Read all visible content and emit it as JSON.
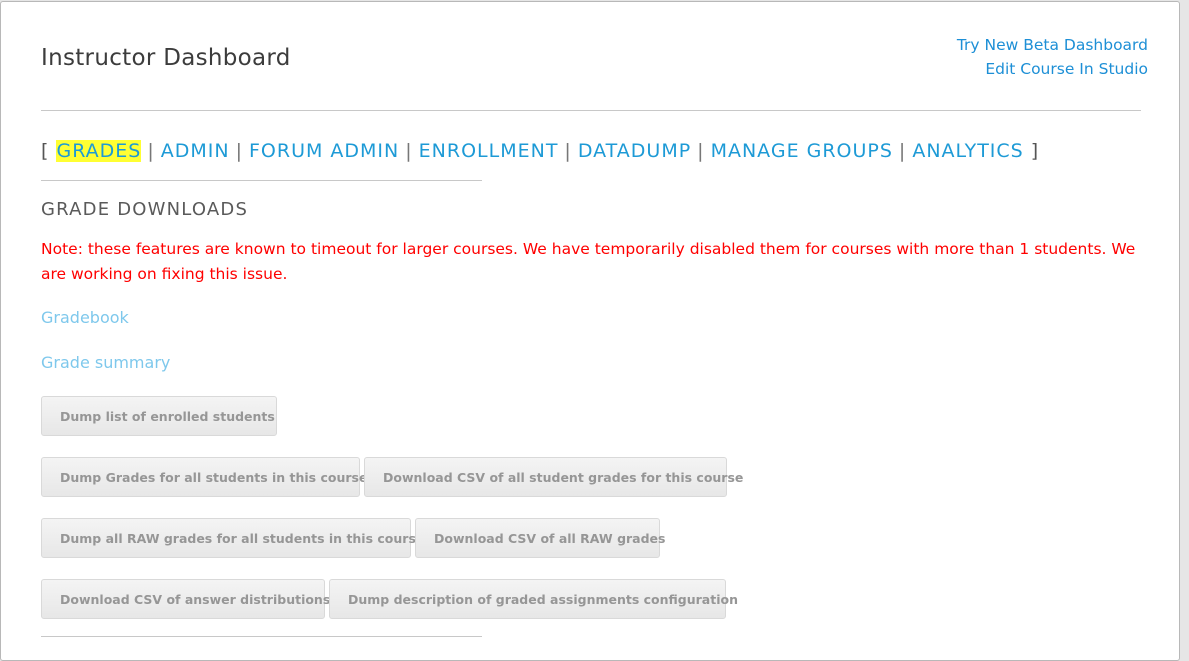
{
  "header": {
    "title": "Instructor Dashboard",
    "links": [
      {
        "label": "Try New Beta Dashboard"
      },
      {
        "label": "Edit Course In Studio"
      }
    ]
  },
  "tabs": {
    "open_bracket": "[",
    "close_bracket": "]",
    "separator": "|",
    "items": [
      {
        "label": "GRADES",
        "active": true
      },
      {
        "label": "ADMIN",
        "active": false
      },
      {
        "label": "FORUM ADMIN",
        "active": false
      },
      {
        "label": "ENROLLMENT",
        "active": false
      },
      {
        "label": "DATADUMP",
        "active": false
      },
      {
        "label": "MANAGE GROUPS",
        "active": false
      },
      {
        "label": "ANALYTICS",
        "active": false
      }
    ]
  },
  "section": {
    "title": "GRADE DOWNLOADS",
    "note": "Note: these features are known to timeout for larger courses. We have temporarily disabled them for courses with more than 1 students. We are working on fixing this issue.",
    "links": [
      {
        "label": "Gradebook"
      },
      {
        "label": "Grade summary"
      }
    ],
    "buttons": [
      {
        "label": "Dump list of enrolled students"
      },
      {
        "label": "Dump Grades for all students in this course"
      },
      {
        "label": "Download CSV of all student grades for this course"
      },
      {
        "label": "Dump all RAW grades for all students in this course"
      },
      {
        "label": "Download CSV of all RAW grades"
      },
      {
        "label": "Download CSV of answer distributions"
      },
      {
        "label": "Dump description of graded assignments configuration"
      }
    ]
  },
  "colors": {
    "link": "#1d9ad6",
    "active_highlight": "#ffff33",
    "warning": "#ff0000",
    "light_link": "#7ec8ec",
    "button_text": "#969696"
  }
}
